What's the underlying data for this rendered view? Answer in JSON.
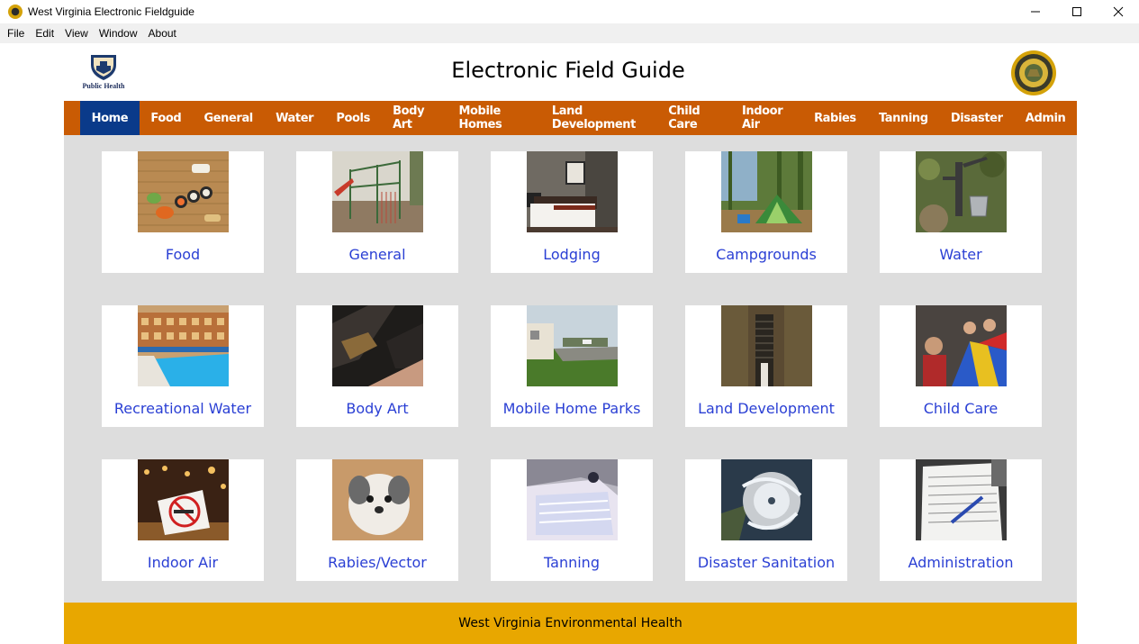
{
  "window": {
    "title": "West Virginia Electronic Fieldguide",
    "menu": [
      "File",
      "Edit",
      "View",
      "Window",
      "About"
    ]
  },
  "header": {
    "logo_caption": "Public Health",
    "title": "Electronic Field Guide",
    "seal_caption": "STATE OF WEST VIRGINIA"
  },
  "nav": {
    "items": [
      "Home",
      "Food",
      "General",
      "Water",
      "Pools",
      "Body Art",
      "Mobile Homes",
      "Land Development",
      "Child Care",
      "Indoor Air",
      "Rabies",
      "Tanning",
      "Disaster",
      "Admin"
    ],
    "active": "Home"
  },
  "tiles": [
    {
      "label": "Food",
      "image": "sushi-photo"
    },
    {
      "label": "General",
      "image": "playground-photo"
    },
    {
      "label": "Lodging",
      "image": "hotel-room-photo"
    },
    {
      "label": "Campgrounds",
      "image": "tent-photo"
    },
    {
      "label": "Water",
      "image": "water-pump-photo"
    },
    {
      "label": "Recreational Water",
      "image": "pool-photo"
    },
    {
      "label": "Body Art",
      "image": "tattoo-photo"
    },
    {
      "label": "Mobile Home Parks",
      "image": "mobile-home-photo"
    },
    {
      "label": "Land Development",
      "image": "septic-pipe-photo"
    },
    {
      "label": "Child Care",
      "image": "children-parachute-photo"
    },
    {
      "label": "Indoor Air",
      "image": "no-smoking-sign-photo"
    },
    {
      "label": "Rabies/Vector",
      "image": "puppy-photo"
    },
    {
      "label": "Tanning",
      "image": "tanning-bed-photo"
    },
    {
      "label": "Disaster Sanitation",
      "image": "hurricane-photo"
    },
    {
      "label": "Administration",
      "image": "paperwork-photo"
    }
  ],
  "footer": {
    "text": "West Virginia Environmental Health"
  },
  "colors": {
    "nav": "#c95b04",
    "nav_active": "#0a3a8a",
    "content_bg": "#dddddd",
    "footer": "#e8a700",
    "link": "#2a3fd4"
  }
}
